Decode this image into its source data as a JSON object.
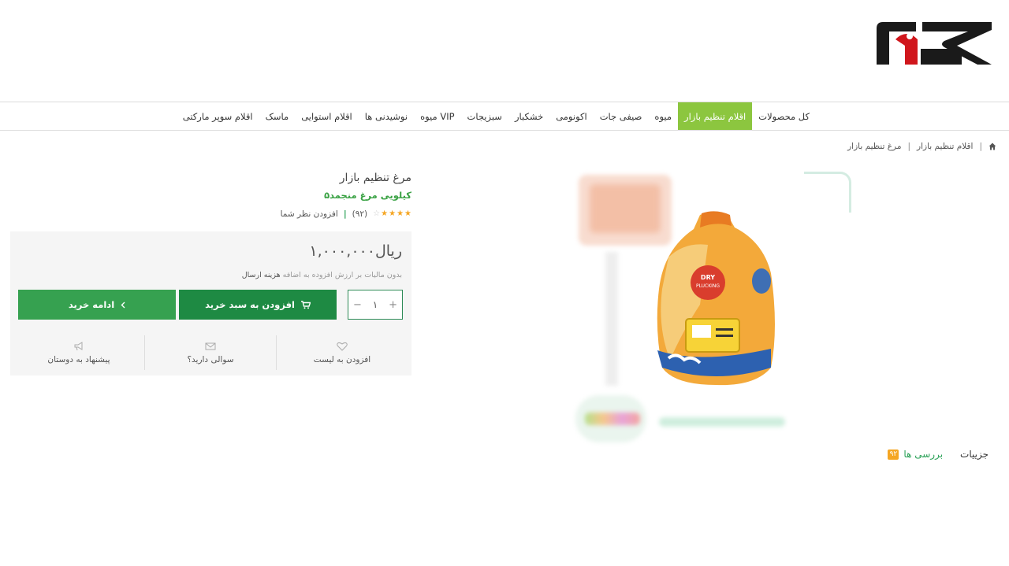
{
  "nav": {
    "items": [
      {
        "label": "کل محصولات"
      },
      {
        "label": "اقلام تنظیم بازار",
        "active": true
      },
      {
        "label": "میوه"
      },
      {
        "label": "صیفی جات"
      },
      {
        "label": "اکونومی"
      },
      {
        "label": "خشکبار"
      },
      {
        "label": "سبزیجات"
      },
      {
        "label": "میوه VIP"
      },
      {
        "label": "نوشیدنی ها"
      },
      {
        "label": "اقلام استوایی"
      },
      {
        "label": "ماسک"
      },
      {
        "label": "اقلام سوپر مارکتی"
      }
    ]
  },
  "breadcrumb": {
    "items": [
      "اقلام تنظیم بازار",
      "مرغ تنظیم بازار"
    ],
    "separator": "|"
  },
  "product": {
    "title": "مرغ تنظیم بازار",
    "subtitle": "۵کیلویی مرغ منجمد",
    "rating": {
      "stars_filled": 4,
      "stars_total": 5,
      "count": "(۹۲)",
      "separator": "|",
      "add_review": "افزودن نظر شما"
    },
    "price": "۱,۰۰۰,۰۰۰ریال",
    "tax_note": "بدون مالیات بر ارزش افزوده به اضافه",
    "tax_note_strong": "هزینه ارسال",
    "quantity": "۱",
    "qty_plus": "+",
    "qty_minus": "−",
    "add_to_cart": "افزودن به سبد خرید",
    "continue_shopping": "ادامه خرید",
    "actions": {
      "wishlist": "افزودن به لیست",
      "question": "سوالی دارید؟",
      "suggest": "پیشنهاد به دوستان"
    }
  },
  "tabs": {
    "details": "جزییات",
    "reviews": "بررسی ها",
    "reviews_badge": "۹۲"
  },
  "colors": {
    "nav_active": "#8cc63f",
    "cart_button": "#1e8a43",
    "continue_button": "#36a150",
    "accent_green": "#2aa157",
    "star": "#f5a623",
    "logo_red": "#d0161c"
  }
}
